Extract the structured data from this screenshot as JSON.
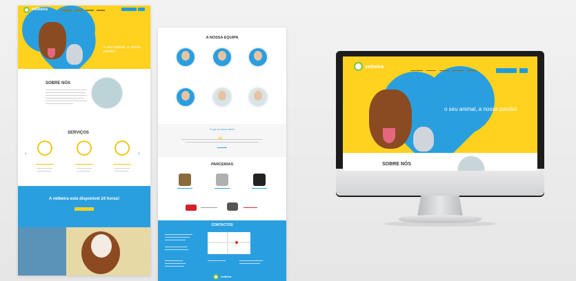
{
  "brand": {
    "logo_text": "vetbeira",
    "accent_yellow": "#ffd21f",
    "accent_blue": "#2a9fe0",
    "accent_green": "#7cc242"
  },
  "left": {
    "tagline": "o seu animal, a nossa paixão!",
    "about_title": "SOBRE NÓS",
    "services_title": "SERVIÇOS",
    "band_title": "A vetbeira está disponível 24 horas!"
  },
  "middle": {
    "team_title": "A NOSSA EQUIPA",
    "quote_title": "O que os nossos dizem",
    "partners_title": "PARCERIAS",
    "contact_title": "CONTACTOS"
  },
  "monitor": {
    "tagline": "o seu animal, a nossa paixão!",
    "about_title": "SOBRE NÓS"
  },
  "icons": [
    "vetbeira-logo-icon",
    "paw-icon",
    "arrow-left-icon",
    "arrow-right-icon",
    "quote-icon",
    "map-pin-icon"
  ]
}
